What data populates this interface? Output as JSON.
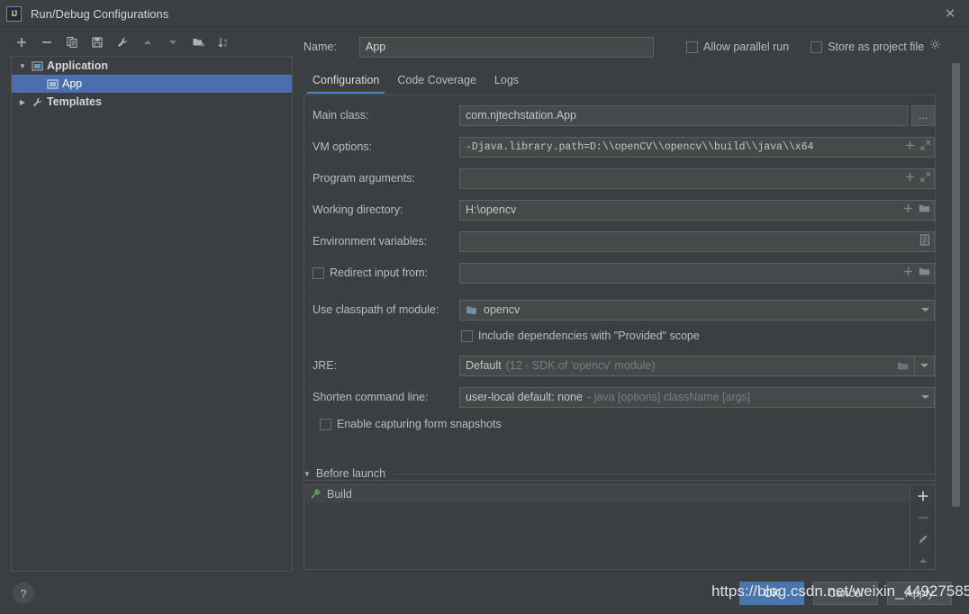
{
  "window": {
    "title": "Run/Debug Configurations",
    "app_icon": "intellij-idea-icon",
    "close_label": "✕"
  },
  "toolbar": {
    "buttons": [
      {
        "name": "add-configuration-button",
        "icon": "plus-icon"
      },
      {
        "name": "remove-configuration-button",
        "icon": "minus-icon"
      },
      {
        "name": "copy-configuration-button",
        "icon": "copy-icon"
      },
      {
        "name": "save-configuration-button",
        "icon": "save-icon"
      },
      {
        "name": "edit-templates-button",
        "icon": "wrench-icon"
      },
      {
        "name": "move-up-button",
        "icon": "arrow-up-icon"
      },
      {
        "name": "move-down-button",
        "icon": "arrow-down-icon"
      },
      {
        "name": "new-folder-button",
        "icon": "folder-add-icon"
      },
      {
        "name": "sort-configurations-button",
        "icon": "sort-az-icon"
      }
    ]
  },
  "tree": {
    "nodes": [
      {
        "label": "Application",
        "icon": "application-icon",
        "arrow": "▼",
        "level": 0,
        "selected": false,
        "bold": true
      },
      {
        "label": "App",
        "icon": "application-icon",
        "arrow": "",
        "level": 1,
        "selected": true,
        "bold": false
      },
      {
        "label": "Templates",
        "icon": "wrench-icon",
        "arrow": "▶",
        "level": 0,
        "selected": false,
        "bold": true
      }
    ]
  },
  "header": {
    "name_label": "Name:",
    "name_value": "App",
    "name_placeholder": "Name",
    "allow_parallel_run": {
      "label": "Allow parallel run",
      "checked": false
    },
    "store_as_project_file": {
      "label": "Store as project file",
      "checked": false
    },
    "gear_icon": "gear-icon"
  },
  "tabs": [
    {
      "label": "Configuration",
      "active": true
    },
    {
      "label": "Code Coverage",
      "active": false
    },
    {
      "label": "Logs",
      "active": false
    }
  ],
  "form": {
    "main_class": {
      "label": "Main class:",
      "value": "com.njtechstation.App",
      "browse_label": "..."
    },
    "vm_options": {
      "label": "VM options:",
      "value": "-Djava.library.path=D:\\\\openCV\\\\opencv\\\\build\\\\java\\\\x64",
      "icons": [
        "plus-icon",
        "expand-icon"
      ]
    },
    "program_arguments": {
      "label": "Program arguments:",
      "value": "",
      "icons": [
        "plus-icon",
        "expand-icon"
      ]
    },
    "working_directory": {
      "label": "Working directory:",
      "value": "H:\\opencv",
      "icons": [
        "plus-icon",
        "folder-icon"
      ]
    },
    "environment_variables": {
      "label": "Environment variables:",
      "value": "",
      "icons": [
        "list-editor-icon"
      ]
    },
    "redirect_input": {
      "label": "Redirect input from:",
      "checked": false,
      "value": "",
      "icons": [
        "plus-icon",
        "folder-icon"
      ]
    },
    "use_classpath_of_module": {
      "label": "Use classpath of module:",
      "value": "opencv",
      "icon": "module-icon",
      "arrow": "chevron-down-icon"
    },
    "include_provided_scope": {
      "label": "Include dependencies with \"Provided\" scope",
      "checked": false
    },
    "jre": {
      "label": "JRE:",
      "value": "Default",
      "hint": "(12 - SDK of 'opencv' module)",
      "icons": [
        "folder-icon",
        "chevron-down-icon"
      ]
    },
    "shorten_command_line": {
      "label": "Shorten command line:",
      "value": "user-local default: none",
      "hint": "- java [options] className [args]",
      "arrow": "chevron-down-icon"
    },
    "enable_form_snapshots": {
      "label": "Enable capturing form snapshots",
      "checked": false
    }
  },
  "before_launch": {
    "title": "Before launch",
    "collapse_arrow": "▼",
    "items": [
      {
        "label": "Build",
        "icon": "build-hammer-icon"
      }
    ],
    "side_buttons": [
      {
        "name": "add-task-button",
        "icon": "plus-icon",
        "label": "+"
      },
      {
        "name": "remove-task-button",
        "icon": "minus-icon",
        "label": "−"
      },
      {
        "name": "edit-task-button",
        "icon": "pencil-icon",
        "label": ""
      },
      {
        "name": "move-task-up-button",
        "icon": "arrow-up-icon",
        "label": ""
      }
    ]
  },
  "footer": {
    "help_label": "?",
    "ok_label": "OK",
    "cancel_label": "Cancel",
    "apply_label": "Apply"
  },
  "watermark": {
    "text": "https://blog.csdn.net/weixin_44927585"
  },
  "colors": {
    "background": "#3c3f41",
    "field_background": "#45494a",
    "selection": "#4b6eaf",
    "accent": "#4a88c7",
    "primary_button": "#4a75ac",
    "border": "#4e5254",
    "text": "#bbbbbb"
  }
}
